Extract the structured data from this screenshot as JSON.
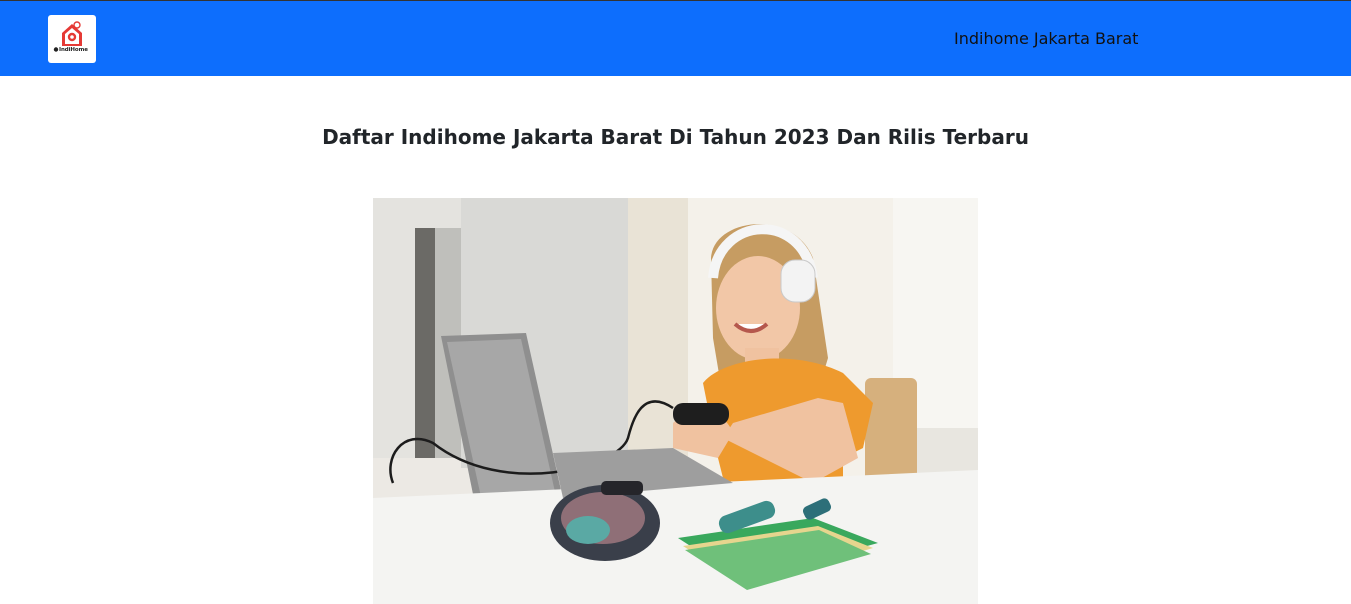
{
  "navbar": {
    "logo": {
      "icon": "indihome-house-icon",
      "wordmark": "IndiHome",
      "accent_color": "#e53935"
    },
    "brand_link": "Indihome Jakarta Barat",
    "background_color": "#0d6efd"
  },
  "article": {
    "title": "Daftar Indihome Jakarta Barat Di Tahun 2023 Dan Rilis Terbaru",
    "image": {
      "subject": "girl-with-headphones-gaming-image"
    }
  }
}
